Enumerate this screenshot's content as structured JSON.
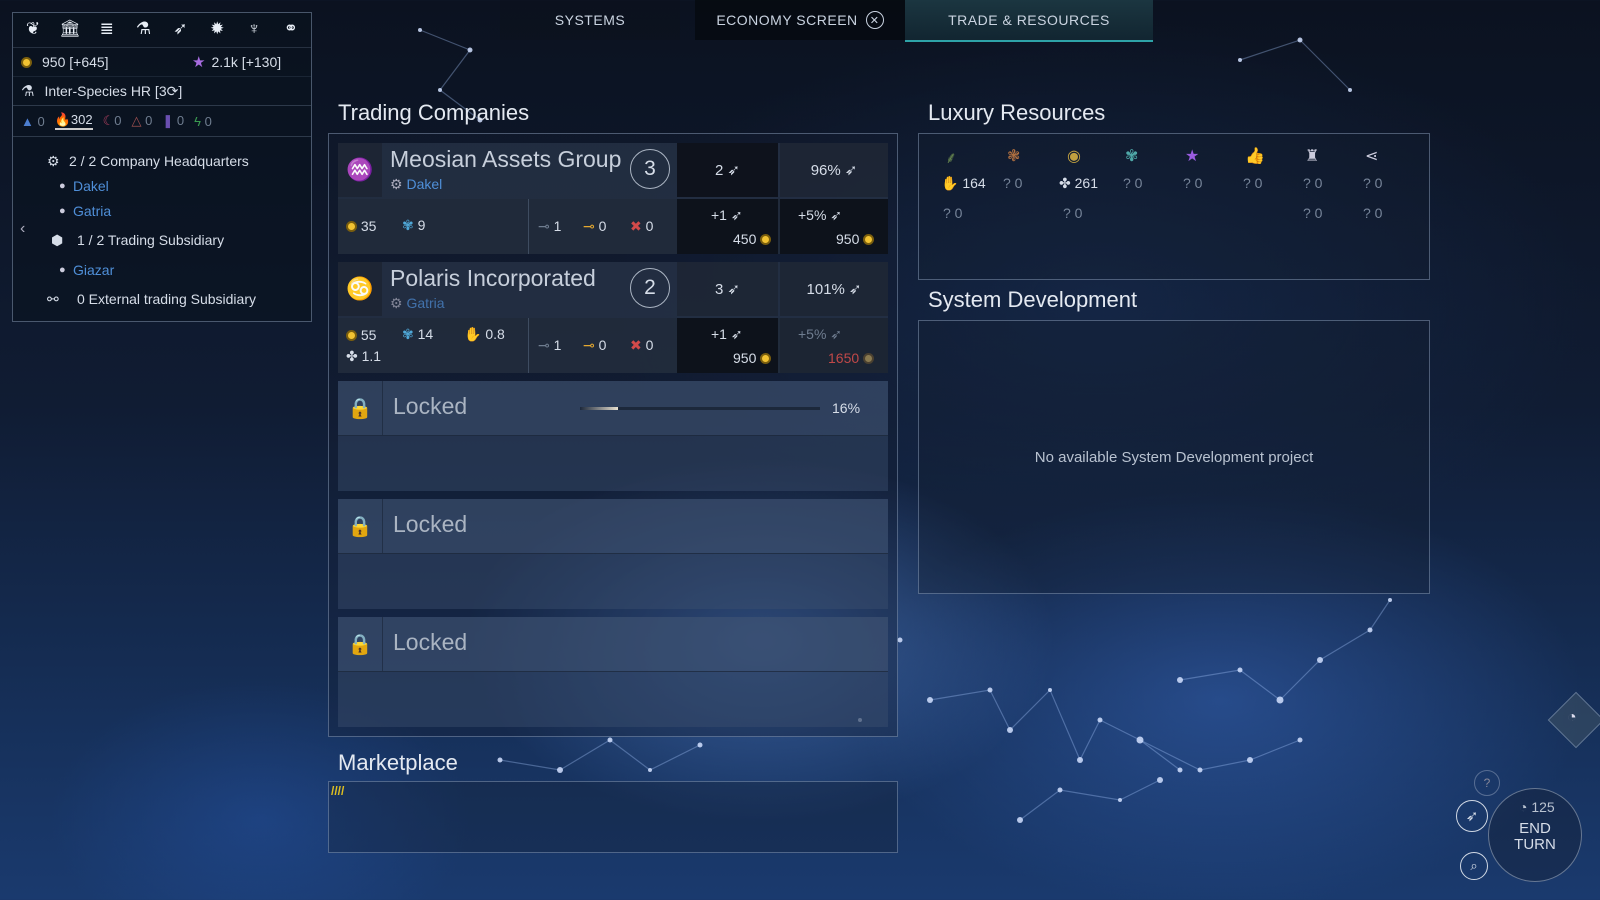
{
  "tabs": [
    {
      "label": "SYSTEMS"
    },
    {
      "label": "ECONOMY SCREEN"
    },
    {
      "label": "TRADE & RESOURCES"
    }
  ],
  "top_panel": {
    "dust": "950 [+645]",
    "influence": "2.1k [+130]",
    "research": "Inter-Species HR [3⟳]",
    "strategic": [
      "0",
      "302",
      "0",
      "0",
      "0",
      "0"
    ],
    "hq": "2 / 2 Company Headquarters",
    "hq_systems": [
      "Dakel",
      "Gatria"
    ],
    "subsidiary": "1 / 2 Trading Subsidiary",
    "subsidiary_systems": [
      "Giazar"
    ],
    "external": "0 External trading Subsidiary"
  },
  "trading": {
    "title": "Trading Companies",
    "companies": [
      {
        "name": "Meosian Assets Group",
        "hq": "Dakel",
        "level": "3",
        "slots": "2",
        "pct": "96%",
        "res": [
          "35",
          "9"
        ],
        "extra_res": [],
        "routes": [
          "1",
          "0",
          "0"
        ],
        "upgrade1": "+1",
        "cost1": "450",
        "upgrade2": "+5%",
        "cost2": "950"
      },
      {
        "name": "Polaris Incorporated",
        "hq": "Gatria",
        "level": "2",
        "slots": "3",
        "pct": "101%",
        "res": [
          "55",
          "14",
          "0.8"
        ],
        "extra_res": [
          "1.1"
        ],
        "routes": [
          "1",
          "0",
          "0"
        ],
        "upgrade1": "+1",
        "cost1": "950",
        "upgrade2": "+5%",
        "cost2": "1650"
      }
    ],
    "locked": [
      {
        "label": "Locked",
        "progress": "16%",
        "progress_value": 0.16
      },
      {
        "label": "Locked"
      },
      {
        "label": "Locked"
      }
    ]
  },
  "marketplace": {
    "title": "Marketplace"
  },
  "luxury": {
    "title": "Luxury Resources",
    "row1": [
      "164",
      "? 0",
      "261",
      "? 0",
      "? 0",
      "? 0",
      "? 0",
      "? 0"
    ],
    "row2": [
      "? 0",
      "",
      "? 0",
      "",
      "",
      "",
      "? 0",
      "? 0"
    ]
  },
  "sysdev": {
    "title": "System Development",
    "empty": "No available System Development project"
  },
  "end_turn": {
    "turn": "125",
    "label1": "END",
    "label2": "TURN"
  },
  "colors": {
    "gold": "#f1c232",
    "blue_link": "#4f8fd8",
    "red": "#d24a4a"
  }
}
